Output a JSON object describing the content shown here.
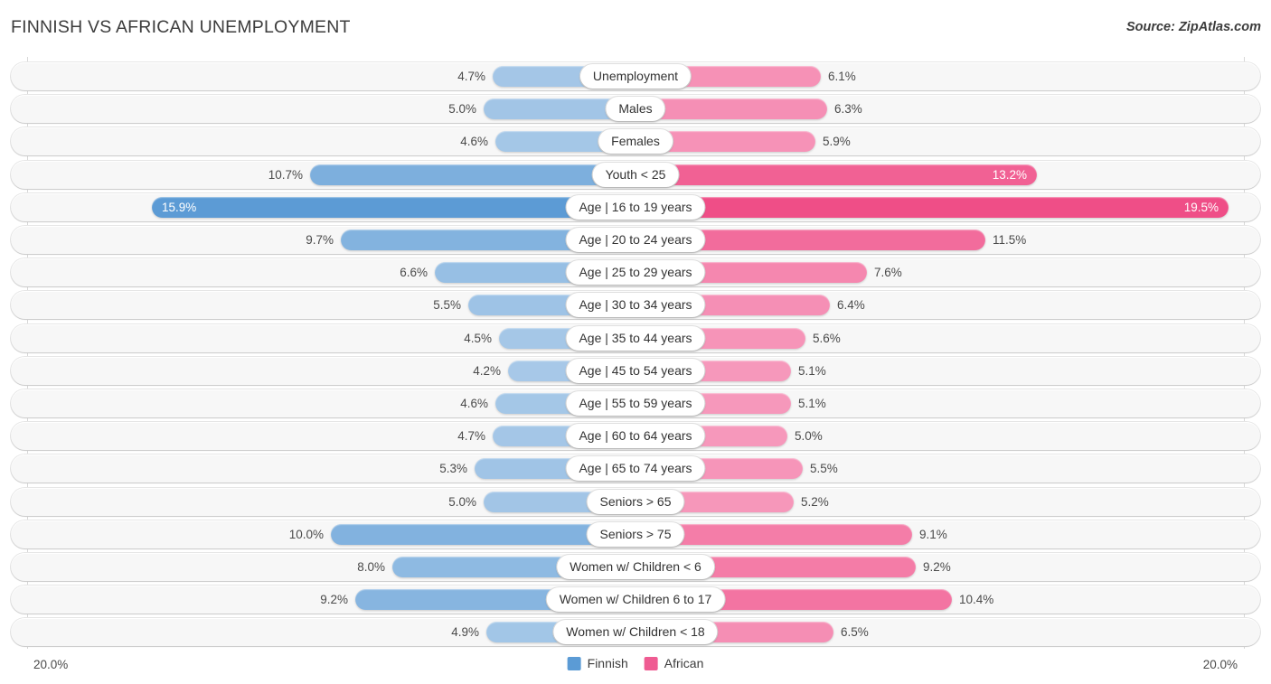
{
  "header": {
    "title": "FINNISH VS AFRICAN UNEMPLOYMENT",
    "source": "Source: ZipAtlas.com"
  },
  "footer": {
    "axis_left": "20.0%",
    "axis_right": "20.0%",
    "legend": [
      {
        "label": "Finnish",
        "color": "#5b9bd5"
      },
      {
        "label": "African",
        "color": "#ef5b92"
      }
    ]
  },
  "chart_data": {
    "type": "bar",
    "title": "FINNISH VS AFRICAN UNEMPLOYMENT",
    "subtitle": "Source: ZipAtlas.com",
    "orientation": "horizontal-diverging",
    "xlabel": "",
    "ylabel": "",
    "xlim": [
      0,
      20
    ],
    "axis_max_label": "20.0%",
    "grid": true,
    "legend_position": "bottom-center",
    "categories": [
      "Unemployment",
      "Males",
      "Females",
      "Youth < 25",
      "Age | 16 to 19 years",
      "Age | 20 to 24 years",
      "Age | 25 to 29 years",
      "Age | 30 to 34 years",
      "Age | 35 to 44 years",
      "Age | 45 to 54 years",
      "Age | 55 to 59 years",
      "Age | 60 to 64 years",
      "Age | 65 to 74 years",
      "Seniors > 65",
      "Seniors > 75",
      "Women w/ Children < 6",
      "Women w/ Children 6 to 17",
      "Women w/ Children < 18"
    ],
    "series": [
      {
        "name": "Finnish",
        "color": "#5b9bd5",
        "values": [
          4.7,
          5.0,
          4.6,
          10.7,
          15.9,
          9.7,
          6.6,
          5.5,
          4.5,
          4.2,
          4.6,
          4.7,
          5.3,
          5.0,
          10.0,
          8.0,
          9.2,
          4.9
        ],
        "labels": [
          "4.7%",
          "5.0%",
          "4.6%",
          "10.7%",
          "15.9%",
          "9.7%",
          "6.6%",
          "5.5%",
          "4.5%",
          "4.2%",
          "4.6%",
          "4.7%",
          "5.3%",
          "5.0%",
          "10.0%",
          "8.0%",
          "9.2%",
          "4.9%"
        ]
      },
      {
        "name": "African",
        "color": "#ef5b92",
        "values": [
          6.1,
          6.3,
          5.9,
          13.2,
          19.5,
          11.5,
          7.6,
          6.4,
          5.6,
          5.1,
          5.1,
          5.0,
          5.5,
          5.2,
          9.1,
          9.2,
          10.4,
          6.5
        ],
        "labels": [
          "6.1%",
          "6.3%",
          "5.9%",
          "13.2%",
          "19.5%",
          "11.5%",
          "7.6%",
          "6.4%",
          "5.6%",
          "5.1%",
          "5.1%",
          "5.0%",
          "5.5%",
          "5.2%",
          "9.1%",
          "9.2%",
          "10.4%",
          "6.5%"
        ]
      }
    ]
  },
  "rows": [
    {
      "label": "Unemployment",
      "left": "4.7%",
      "right": "6.1%",
      "lv": 4.7,
      "rv": 6.1
    },
    {
      "label": "Males",
      "left": "5.0%",
      "right": "6.3%",
      "lv": 5.0,
      "rv": 6.3
    },
    {
      "label": "Females",
      "left": "4.6%",
      "right": "5.9%",
      "lv": 4.6,
      "rv": 5.9
    },
    {
      "label": "Youth < 25",
      "left": "10.7%",
      "right": "13.2%",
      "lv": 10.7,
      "rv": 13.2
    },
    {
      "label": "Age | 16 to 19 years",
      "left": "15.9%",
      "right": "19.5%",
      "lv": 15.9,
      "rv": 19.5
    },
    {
      "label": "Age | 20 to 24 years",
      "left": "9.7%",
      "right": "11.5%",
      "lv": 9.7,
      "rv": 11.5
    },
    {
      "label": "Age | 25 to 29 years",
      "left": "6.6%",
      "right": "7.6%",
      "lv": 6.6,
      "rv": 7.6
    },
    {
      "label": "Age | 30 to 34 years",
      "left": "5.5%",
      "right": "6.4%",
      "lv": 5.5,
      "rv": 6.4
    },
    {
      "label": "Age | 35 to 44 years",
      "left": "4.5%",
      "right": "5.6%",
      "lv": 4.5,
      "rv": 5.6
    },
    {
      "label": "Age | 45 to 54 years",
      "left": "4.2%",
      "right": "5.1%",
      "lv": 4.2,
      "rv": 5.1
    },
    {
      "label": "Age | 55 to 59 years",
      "left": "4.6%",
      "right": "5.1%",
      "lv": 4.6,
      "rv": 5.1
    },
    {
      "label": "Age | 60 to 64 years",
      "left": "4.7%",
      "right": "5.0%",
      "lv": 4.7,
      "rv": 5.0
    },
    {
      "label": "Age | 65 to 74 years",
      "left": "5.3%",
      "right": "5.5%",
      "lv": 5.3,
      "rv": 5.5
    },
    {
      "label": "Seniors > 65",
      "left": "5.0%",
      "right": "5.2%",
      "lv": 5.0,
      "rv": 5.2
    },
    {
      "label": "Seniors > 75",
      "left": "10.0%",
      "right": "9.1%",
      "lv": 10.0,
      "rv": 9.1
    },
    {
      "label": "Women w/ Children < 6",
      "left": "8.0%",
      "right": "9.2%",
      "lv": 8.0,
      "rv": 9.2
    },
    {
      "label": "Women w/ Children 6 to 17",
      "left": "9.2%",
      "right": "10.4%",
      "lv": 9.2,
      "rv": 10.4
    },
    {
      "label": "Women w/ Children < 18",
      "left": "4.9%",
      "right": "6.5%",
      "lv": 4.9,
      "rv": 6.5
    }
  ]
}
